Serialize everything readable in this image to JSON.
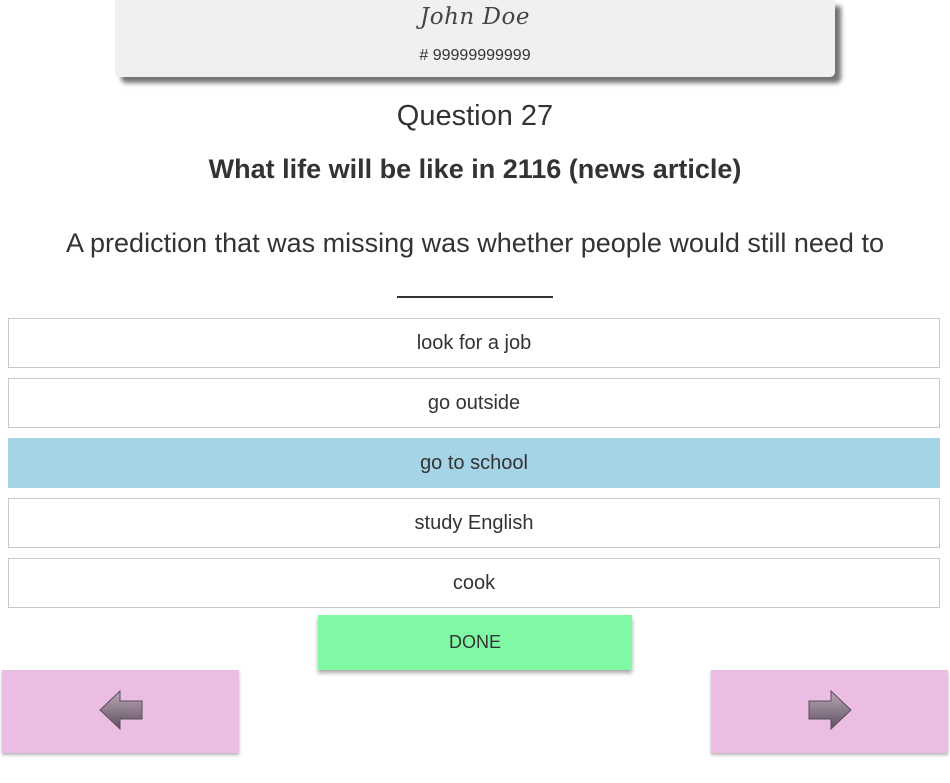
{
  "header": {
    "student_name": "John Doe",
    "student_id": "# 99999999999"
  },
  "question": {
    "number_label": "Question 27",
    "article_title": "What life will be like in 2116 (news article)",
    "prompt": "A prediction that was missing was whether people would still need to"
  },
  "options": [
    {
      "label": "look for a job",
      "selected": false
    },
    {
      "label": "go outside",
      "selected": false
    },
    {
      "label": "go to school",
      "selected": true
    },
    {
      "label": "study English",
      "selected": false
    },
    {
      "label": "cook",
      "selected": false
    }
  ],
  "actions": {
    "done_label": "DONE"
  },
  "navigation": {
    "prev_icon": "arrow-left-icon",
    "next_icon": "arrow-right-icon"
  },
  "colors": {
    "selected_option": "#a4d4e6",
    "done_button": "#80f9a5",
    "nav_button": "#ebbde2",
    "header_card": "#f0f0f0"
  }
}
